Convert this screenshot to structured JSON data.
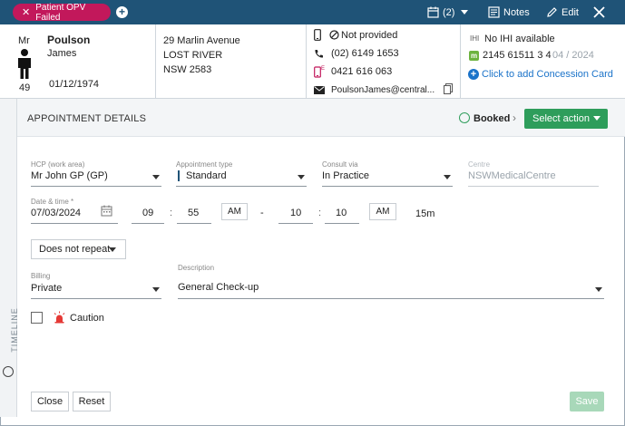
{
  "topbar": {
    "alert": "Patient OPV Failed",
    "appointments_count": "(2)",
    "notes_label": "Notes",
    "edit_label": "Edit"
  },
  "patient": {
    "title": "Mr",
    "surname": "Poulson",
    "given_name": "James",
    "age": "49",
    "dob": "01/12/1974",
    "address_line1": "29 Marlin Avenue",
    "address_line2": "LOST RIVER",
    "address_line3": "NSW 2583",
    "mobile_status": "Not provided",
    "phone": "(02) 6149 1653",
    "mobile": "0421 616 063",
    "email": "PoulsonJames@central...",
    "ihi_tag": "IHI",
    "ihi": "No IHI available",
    "medicare_number": "2145 61511 3 4",
    "medicare_expiry": "04 / 2024",
    "concession_link": "Click to add Concession Card"
  },
  "timeline": {
    "label": "TIMELINE"
  },
  "appointment": {
    "section_title": "APPOINTMENT DETAILS",
    "status": "Booked",
    "select_action": "Select action",
    "hcp_label": "HCP (work area)",
    "hcp_value": "Mr John GP (GP)",
    "type_label": "Appointment type",
    "type_value": "Standard",
    "consult_label": "Consult via",
    "consult_value": "In Practice",
    "centre_label": "Centre",
    "centre_value": "NSWMedicalCentre",
    "datetime_label": "Date & time *",
    "date_value": "07/03/2024",
    "start_hour": "09",
    "start_min": "55",
    "start_ampm": "AM",
    "dash": "-",
    "end_hour": "10",
    "end_min": "10",
    "end_ampm": "AM",
    "colon": ":",
    "duration": "15m",
    "repeat_value": "Does not repeat",
    "billing_label": "Billing",
    "billing_value": "Private",
    "description_label": "Description",
    "description_value": "General Check-up",
    "caution_label": "Caution"
  },
  "footer": {
    "close_label": "Close",
    "reset_label": "Reset",
    "save_label": "Save"
  },
  "colors": {
    "topbar": "#1f5377",
    "alert": "#c2185b",
    "accent_green": "#2e9d5b",
    "link_blue": "#1b73c9"
  }
}
